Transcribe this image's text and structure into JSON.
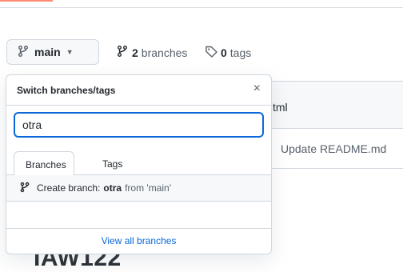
{
  "toolbar": {
    "branch_name": "main",
    "branch_count": "2",
    "branch_word": "branches",
    "tag_count": "0",
    "tag_word": "tags"
  },
  "background": {
    "header_fragment": "tml",
    "commit_message": "Update README.md",
    "readme_heading": "IAW122"
  },
  "dropdown": {
    "title": "Switch branches/tags",
    "close_glyph": "×",
    "filter_value": "otra",
    "tabs": [
      {
        "label": "Branches",
        "active": true
      },
      {
        "label": "Tags",
        "active": false
      }
    ],
    "create_prefix": "Create branch:",
    "create_name": "otra",
    "create_from": "from 'main'",
    "view_all": "View all branches"
  },
  "colors": {
    "accent": "#0969da",
    "tab_underline": "#fd8c73"
  }
}
